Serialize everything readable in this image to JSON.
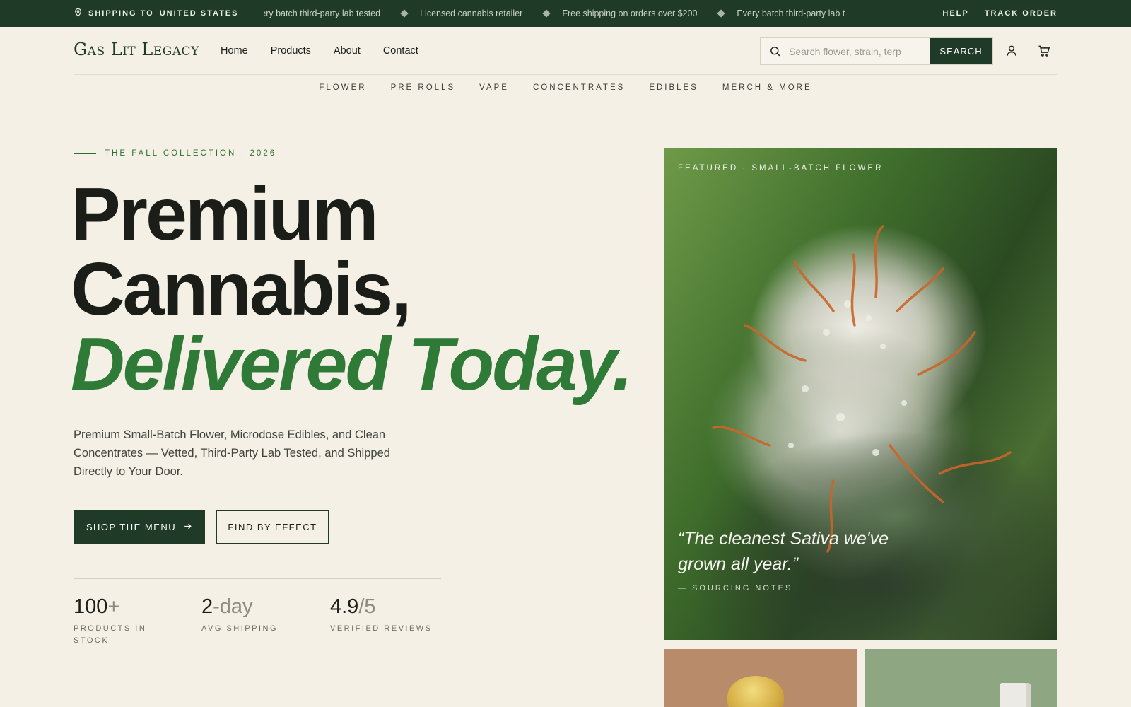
{
  "topbar": {
    "shipping_label": "Shipping to",
    "shipping_country": "United States",
    "ticker": [
      "very batch third-party lab tested",
      "Licensed cannabis retailer",
      "Free shipping on orders over $200",
      "Every batch third-party lab t"
    ],
    "links": [
      "Help",
      "Track Order"
    ]
  },
  "header": {
    "logo": "Gas Lit Legacy",
    "nav": [
      "Home",
      "Products",
      "About",
      "Contact"
    ],
    "search_placeholder": "Search flower, strain, terp",
    "search_button": "SEARCH",
    "categories": [
      "FLOWER",
      "PRE ROLLS",
      "VAPE",
      "CONCENTRATES",
      "EDIBLES",
      "MERCH & MORE"
    ]
  },
  "hero": {
    "eyebrow": "THE FALL COLLECTION · 2026",
    "line1": "Premium",
    "line2": "Cannabis,",
    "line3": "Delivered Today.",
    "lede": "Premium Small-Batch Flower, Microdose Edibles, and Clean Concentrates — Vetted, Third-Party Lab Tested, and Shipped Directly to Your Door.",
    "cta_primary": "SHOP THE MENU",
    "cta_secondary": "FIND BY EFFECT",
    "stats": [
      {
        "value": "100",
        "suffix": "+",
        "label": "PRODUCTS IN STOCK"
      },
      {
        "value": "2",
        "suffix": "-day",
        "label": "AVG SHIPPING"
      },
      {
        "value": "4.9",
        "suffix": "/5",
        "label": "VERIFIED REVIEWS"
      }
    ]
  },
  "feature": {
    "tag": "FEATURED · SMALL-BATCH FLOWER",
    "quote": "“The cleanest Sativa we've grown all year.”",
    "attribution": "— SOURCING NOTES"
  },
  "colors": {
    "brand_dark_green": "#1f3a26",
    "accent_green": "#2f7a36",
    "background": "#f4f0e6"
  },
  "icons": [
    "location-pin-icon",
    "search-icon",
    "user-icon",
    "cart-icon",
    "arrow-right-icon",
    "diamond-icon"
  ]
}
